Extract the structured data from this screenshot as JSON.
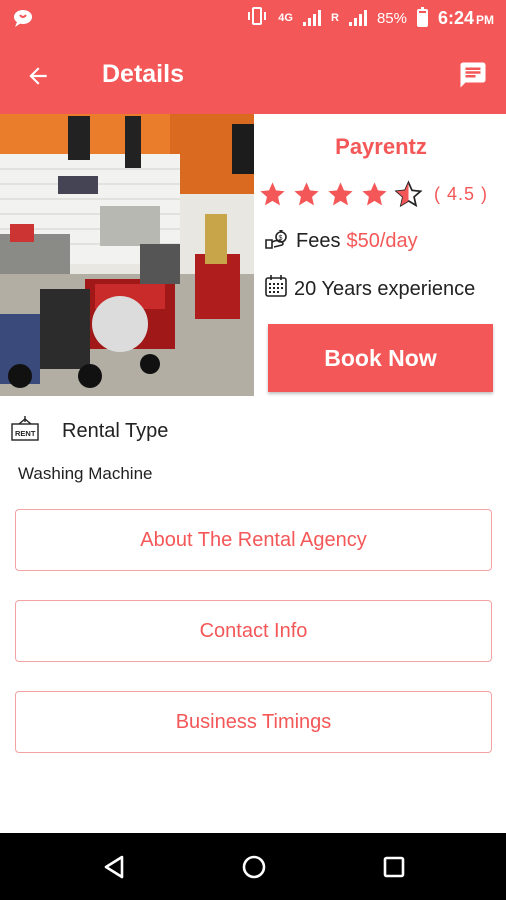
{
  "status_bar": {
    "network": "4G",
    "roaming": "R",
    "battery": "85%",
    "battery_level": 0.85,
    "time": "6:24",
    "ampm": "PM"
  },
  "toolbar": {
    "title": "Details",
    "back_icon": "arrow-back-icon",
    "chat_icon": "chat-icon"
  },
  "agency": {
    "name": "Payrentz",
    "rating": 4.5,
    "rating_text": "( 4.5 )",
    "fees_label": "Fees",
    "fees_value": "$50/day",
    "experience": "20 Years experience",
    "book_label": "Book Now"
  },
  "rental": {
    "type_label": "Rental Type",
    "type_value": "Washing Machine"
  },
  "sections": {
    "about": "About The Rental Agency",
    "contact": "Contact Info",
    "timings": "Business Timings"
  },
  "colors": {
    "accent": "#f45757",
    "button_border": "#f4a3a3"
  }
}
